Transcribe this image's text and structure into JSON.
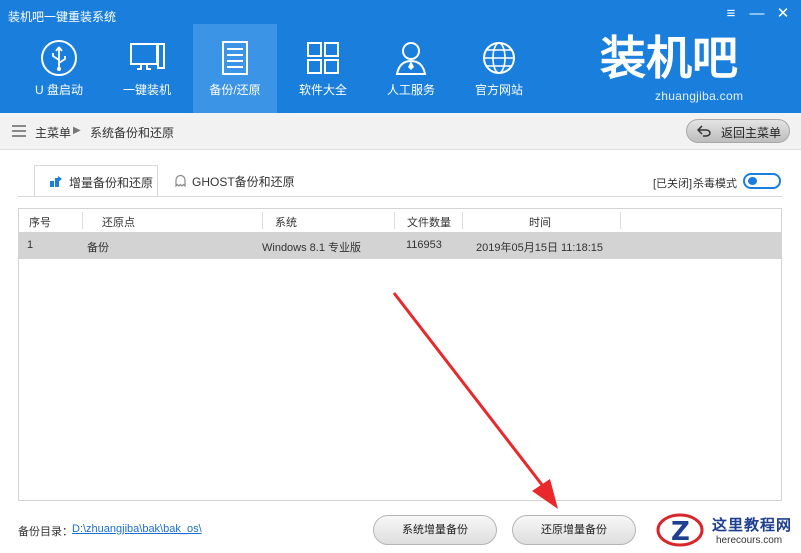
{
  "window": {
    "title": "装机吧一键重装系统",
    "menu_glyph": "≡",
    "minimize_glyph": "—",
    "close_glyph": "✕"
  },
  "nav": {
    "items": [
      {
        "label": "U 盘启动",
        "icon": "usb-icon"
      },
      {
        "label": "一键装机",
        "icon": "monitor-icon"
      },
      {
        "label": "备份/还原",
        "icon": "backup-icon",
        "active": true
      },
      {
        "label": "软件大全",
        "icon": "apps-grid-icon"
      },
      {
        "label": "人工服务",
        "icon": "support-person-icon"
      },
      {
        "label": "官方网站",
        "icon": "globe-icon"
      }
    ]
  },
  "brand": {
    "logo_text": "装机吧",
    "url": "zhuangjiba.com"
  },
  "breadcrumb": {
    "home": "主菜单",
    "separator": "▶",
    "current": "系统备份和还原",
    "back_label": "返回主菜单"
  },
  "tabs": [
    {
      "label": "增量备份和还原",
      "active": true,
      "icon": "incremental-backup-icon"
    },
    {
      "label": "GHOST备份和还原",
      "active": false,
      "icon": "ghost-icon"
    }
  ],
  "antivirus": {
    "status": "[已关闭]",
    "label": "杀毒模式",
    "on": false
  },
  "table": {
    "columns": [
      "序号",
      "还原点",
      "系统",
      "文件数量",
      "时间"
    ],
    "rows": [
      {
        "index": "1",
        "point": "备份",
        "system": "Windows 8.1 专业版",
        "files": "116953",
        "time": "2019年05月15日 11:18:15",
        "selected": true
      }
    ]
  },
  "footer": {
    "dir_label": "备份目录：",
    "dir_path": "D:\\zhuangjiba\\bak\\bak_os\\",
    "btn_system_backup": "系统增量备份",
    "btn_restore_backup": "还原增量备份"
  },
  "watermark": {
    "title": "这里教程网",
    "url": "herecours.com",
    "logo_letter": "Z"
  },
  "colors": {
    "primary": "#1a7fdc",
    "nav_active": "#3b94e6",
    "annotation_arrow": "#e8282b",
    "selected_row": "#d3d3d3"
  }
}
